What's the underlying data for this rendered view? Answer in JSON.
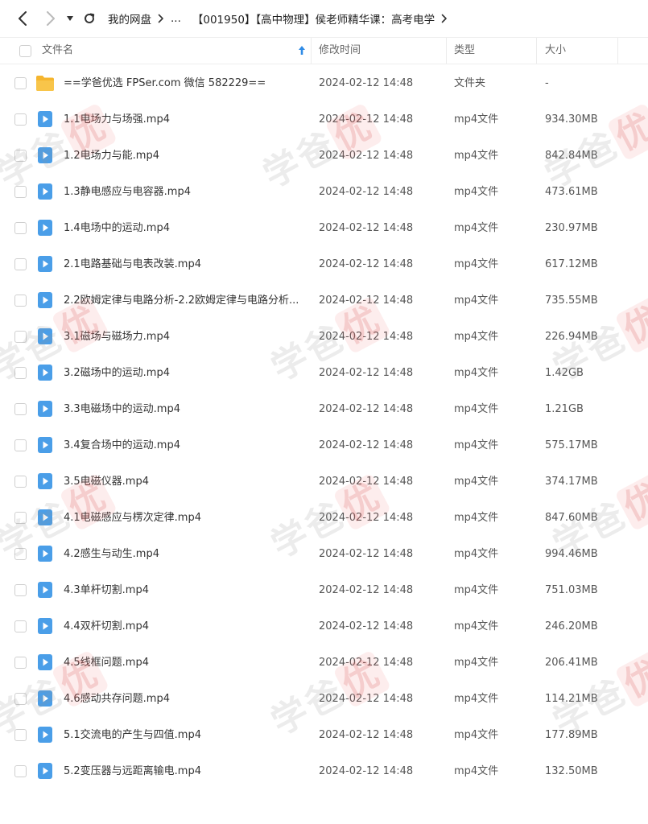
{
  "nav": {
    "back_icon": "arrow-left-icon",
    "forward_icon": "arrow-right-icon",
    "history_icon": "caret-down-icon",
    "refresh_icon": "refresh-icon",
    "breadcrumbs": [
      "我的网盘",
      "...",
      "【001950】【高中物理】侯老师精华课：高考电学"
    ]
  },
  "table": {
    "headers": {
      "name": "文件名",
      "modified": "修改时间",
      "type": "类型",
      "size": "大小"
    },
    "sort_icon": "sort-ascending-arrow-icon",
    "rows": [
      {
        "icon": "folder",
        "name": "==学爸优选 FPSer.com 微信 582229==",
        "modified": "2024-02-12 14:48",
        "type": "文件夹",
        "size": "-"
      },
      {
        "icon": "video",
        "name": "1.1电场力与场强.mp4",
        "modified": "2024-02-12 14:48",
        "type": "mp4文件",
        "size": "934.30MB"
      },
      {
        "icon": "video",
        "name": "1.2电场力与能.mp4",
        "modified": "2024-02-12 14:48",
        "type": "mp4文件",
        "size": "842.84MB"
      },
      {
        "icon": "video",
        "name": "1.3静电感应与电容器.mp4",
        "modified": "2024-02-12 14:48",
        "type": "mp4文件",
        "size": "473.61MB"
      },
      {
        "icon": "video",
        "name": "1.4电场中的运动.mp4",
        "modified": "2024-02-12 14:48",
        "type": "mp4文件",
        "size": "230.97MB"
      },
      {
        "icon": "video",
        "name": "2.1电路基础与电表改装.mp4",
        "modified": "2024-02-12 14:48",
        "type": "mp4文件",
        "size": "617.12MB"
      },
      {
        "icon": "video",
        "name": "2.2欧姆定律与电路分析-2.2欧姆定律与电路分析...",
        "modified": "2024-02-12 14:48",
        "type": "mp4文件",
        "size": "735.55MB"
      },
      {
        "icon": "video",
        "name": "3.1磁场与磁场力.mp4",
        "modified": "2024-02-12 14:48",
        "type": "mp4文件",
        "size": "226.94MB"
      },
      {
        "icon": "video",
        "name": "3.2磁场中的运动.mp4",
        "modified": "2024-02-12 14:48",
        "type": "mp4文件",
        "size": "1.42GB"
      },
      {
        "icon": "video",
        "name": "3.3电磁场中的运动.mp4",
        "modified": "2024-02-12 14:48",
        "type": "mp4文件",
        "size": "1.21GB"
      },
      {
        "icon": "video",
        "name": "3.4复合场中的运动.mp4",
        "modified": "2024-02-12 14:48",
        "type": "mp4文件",
        "size": "575.17MB"
      },
      {
        "icon": "video",
        "name": "3.5电磁仪器.mp4",
        "modified": "2024-02-12 14:48",
        "type": "mp4文件",
        "size": "374.17MB"
      },
      {
        "icon": "video",
        "name": "4.1电磁感应与楞次定律.mp4",
        "modified": "2024-02-12 14:48",
        "type": "mp4文件",
        "size": "847.60MB"
      },
      {
        "icon": "video",
        "name": "4.2感生与动生.mp4",
        "modified": "2024-02-12 14:48",
        "type": "mp4文件",
        "size": "994.46MB"
      },
      {
        "icon": "video",
        "name": "4.3单杆切割.mp4",
        "modified": "2024-02-12 14:48",
        "type": "mp4文件",
        "size": "751.03MB"
      },
      {
        "icon": "video",
        "name": "4.4双杆切割.mp4",
        "modified": "2024-02-12 14:48",
        "type": "mp4文件",
        "size": "246.20MB"
      },
      {
        "icon": "video",
        "name": "4.5线框问题.mp4",
        "modified": "2024-02-12 14:48",
        "type": "mp4文件",
        "size": "206.41MB"
      },
      {
        "icon": "video",
        "name": "4.6感动共存问题.mp4",
        "modified": "2024-02-12 14:48",
        "type": "mp4文件",
        "size": "114.21MB"
      },
      {
        "icon": "video",
        "name": "5.1交流电的产生与四值.mp4",
        "modified": "2024-02-12 14:48",
        "type": "mp4文件",
        "size": "177.89MB"
      },
      {
        "icon": "video",
        "name": "5.2变压器与远距离输电.mp4",
        "modified": "2024-02-12 14:48",
        "type": "mp4文件",
        "size": "132.50MB"
      }
    ]
  },
  "watermark": {
    "text": "学爸",
    "seal": "优"
  },
  "colors": {
    "folder": "#f5b52e",
    "video": "#4a9ee8",
    "sort_arrow": "#2f8be6"
  }
}
